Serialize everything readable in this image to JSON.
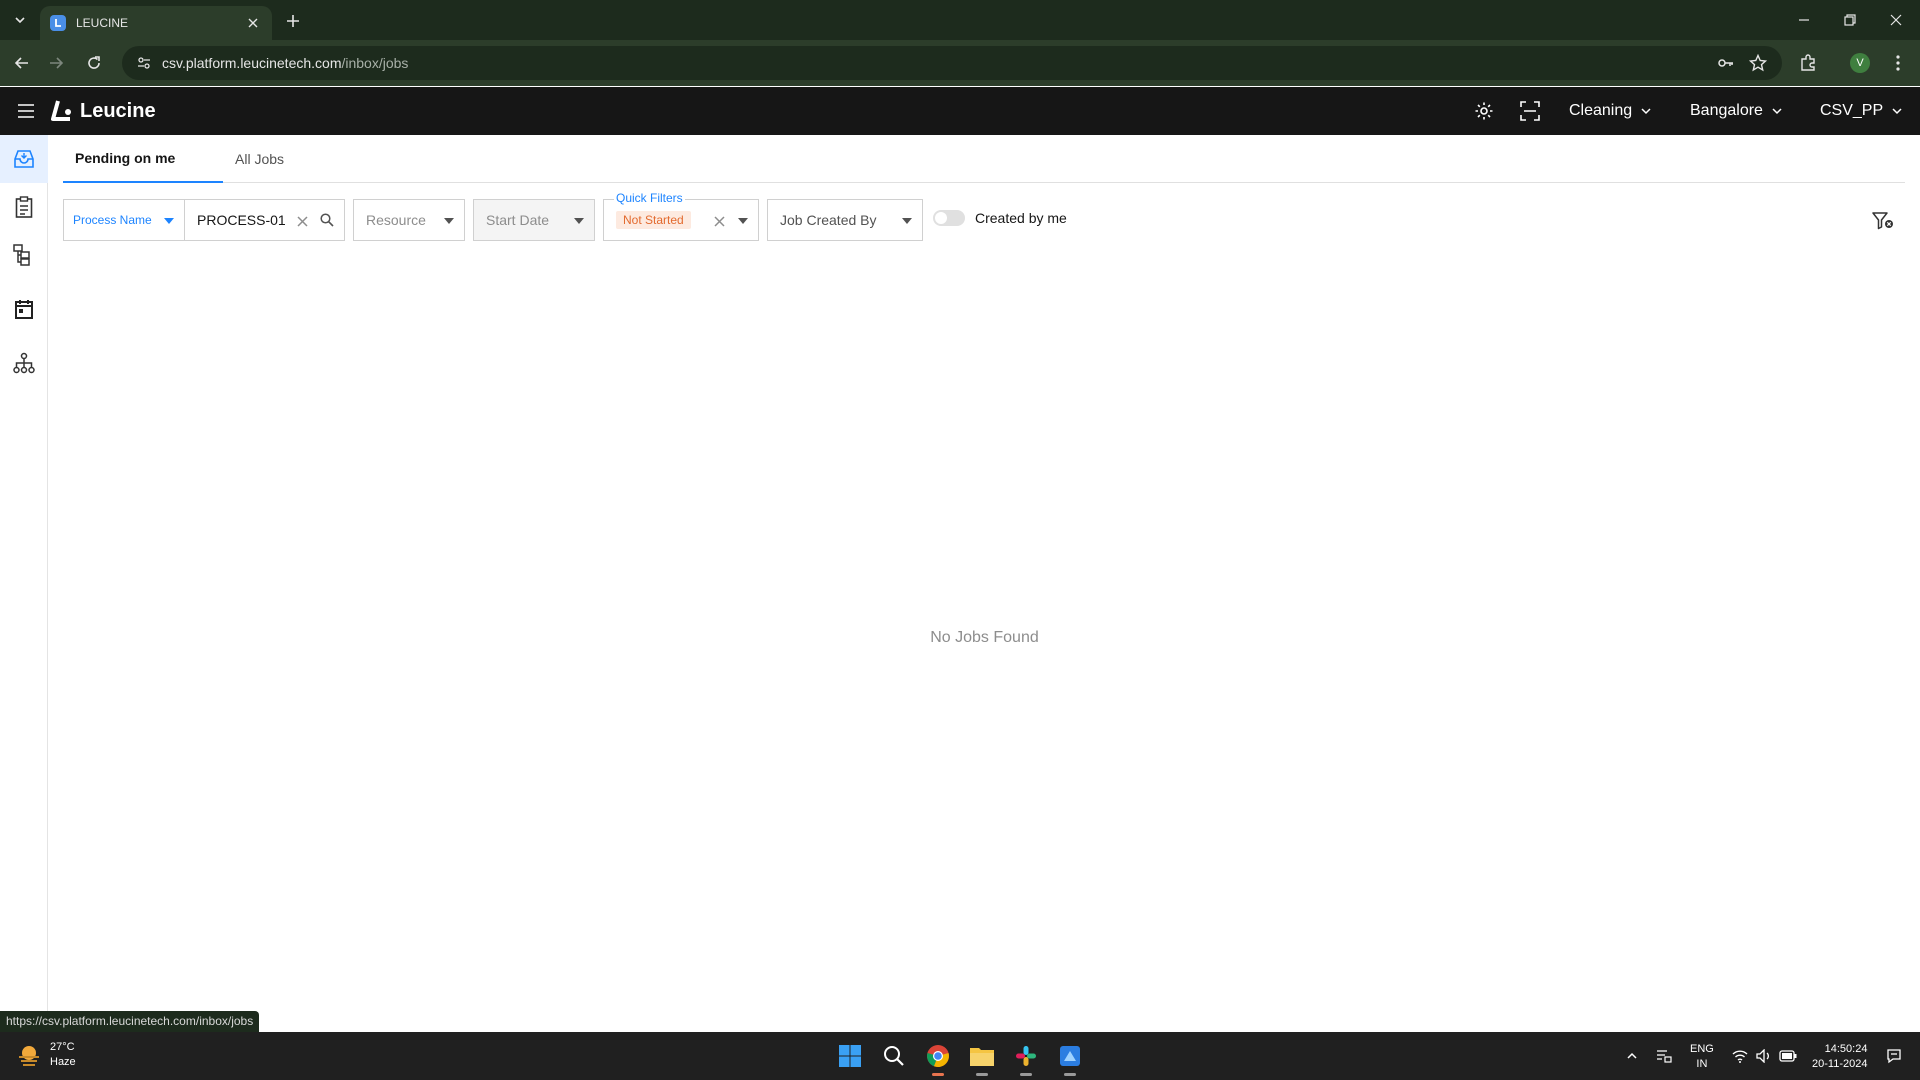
{
  "browser": {
    "tab_title": "LEUCINE",
    "url_host": "csv.platform.leucinetech.com",
    "url_path": "/inbox/jobs",
    "profile_initial": "V",
    "status_url": "https://csv.platform.leucinetech.com/inbox/jobs"
  },
  "app": {
    "logo_text": "Leucine",
    "facility_select": "Cleaning",
    "location_select": "Bangalore",
    "user_select": "CSV_PP"
  },
  "tabs": {
    "pending": "Pending on me",
    "all": "All Jobs"
  },
  "filters": {
    "process_select": "Process Name",
    "process_value": "PROCESS-01",
    "resource_placeholder": "Resource",
    "start_date_placeholder": "Start Date",
    "quick_filters_label": "Quick Filters",
    "quick_filter_chip": "Not Started",
    "job_created_by_placeholder": "Job Created By",
    "created_by_me_label": "Created by me"
  },
  "empty_state": "No Jobs Found",
  "taskbar": {
    "temperature": "27°C",
    "weather": "Haze",
    "lang_top": "ENG",
    "lang_bottom": "IN",
    "time": "14:50:24",
    "date": "20-11-2024"
  },
  "colors": {
    "accent": "#1d84ff",
    "chip_bg": "#fdeae0",
    "chip_text": "#e36a2e",
    "header_bg": "#161616",
    "chrome_bg": "#1d2b1d"
  }
}
